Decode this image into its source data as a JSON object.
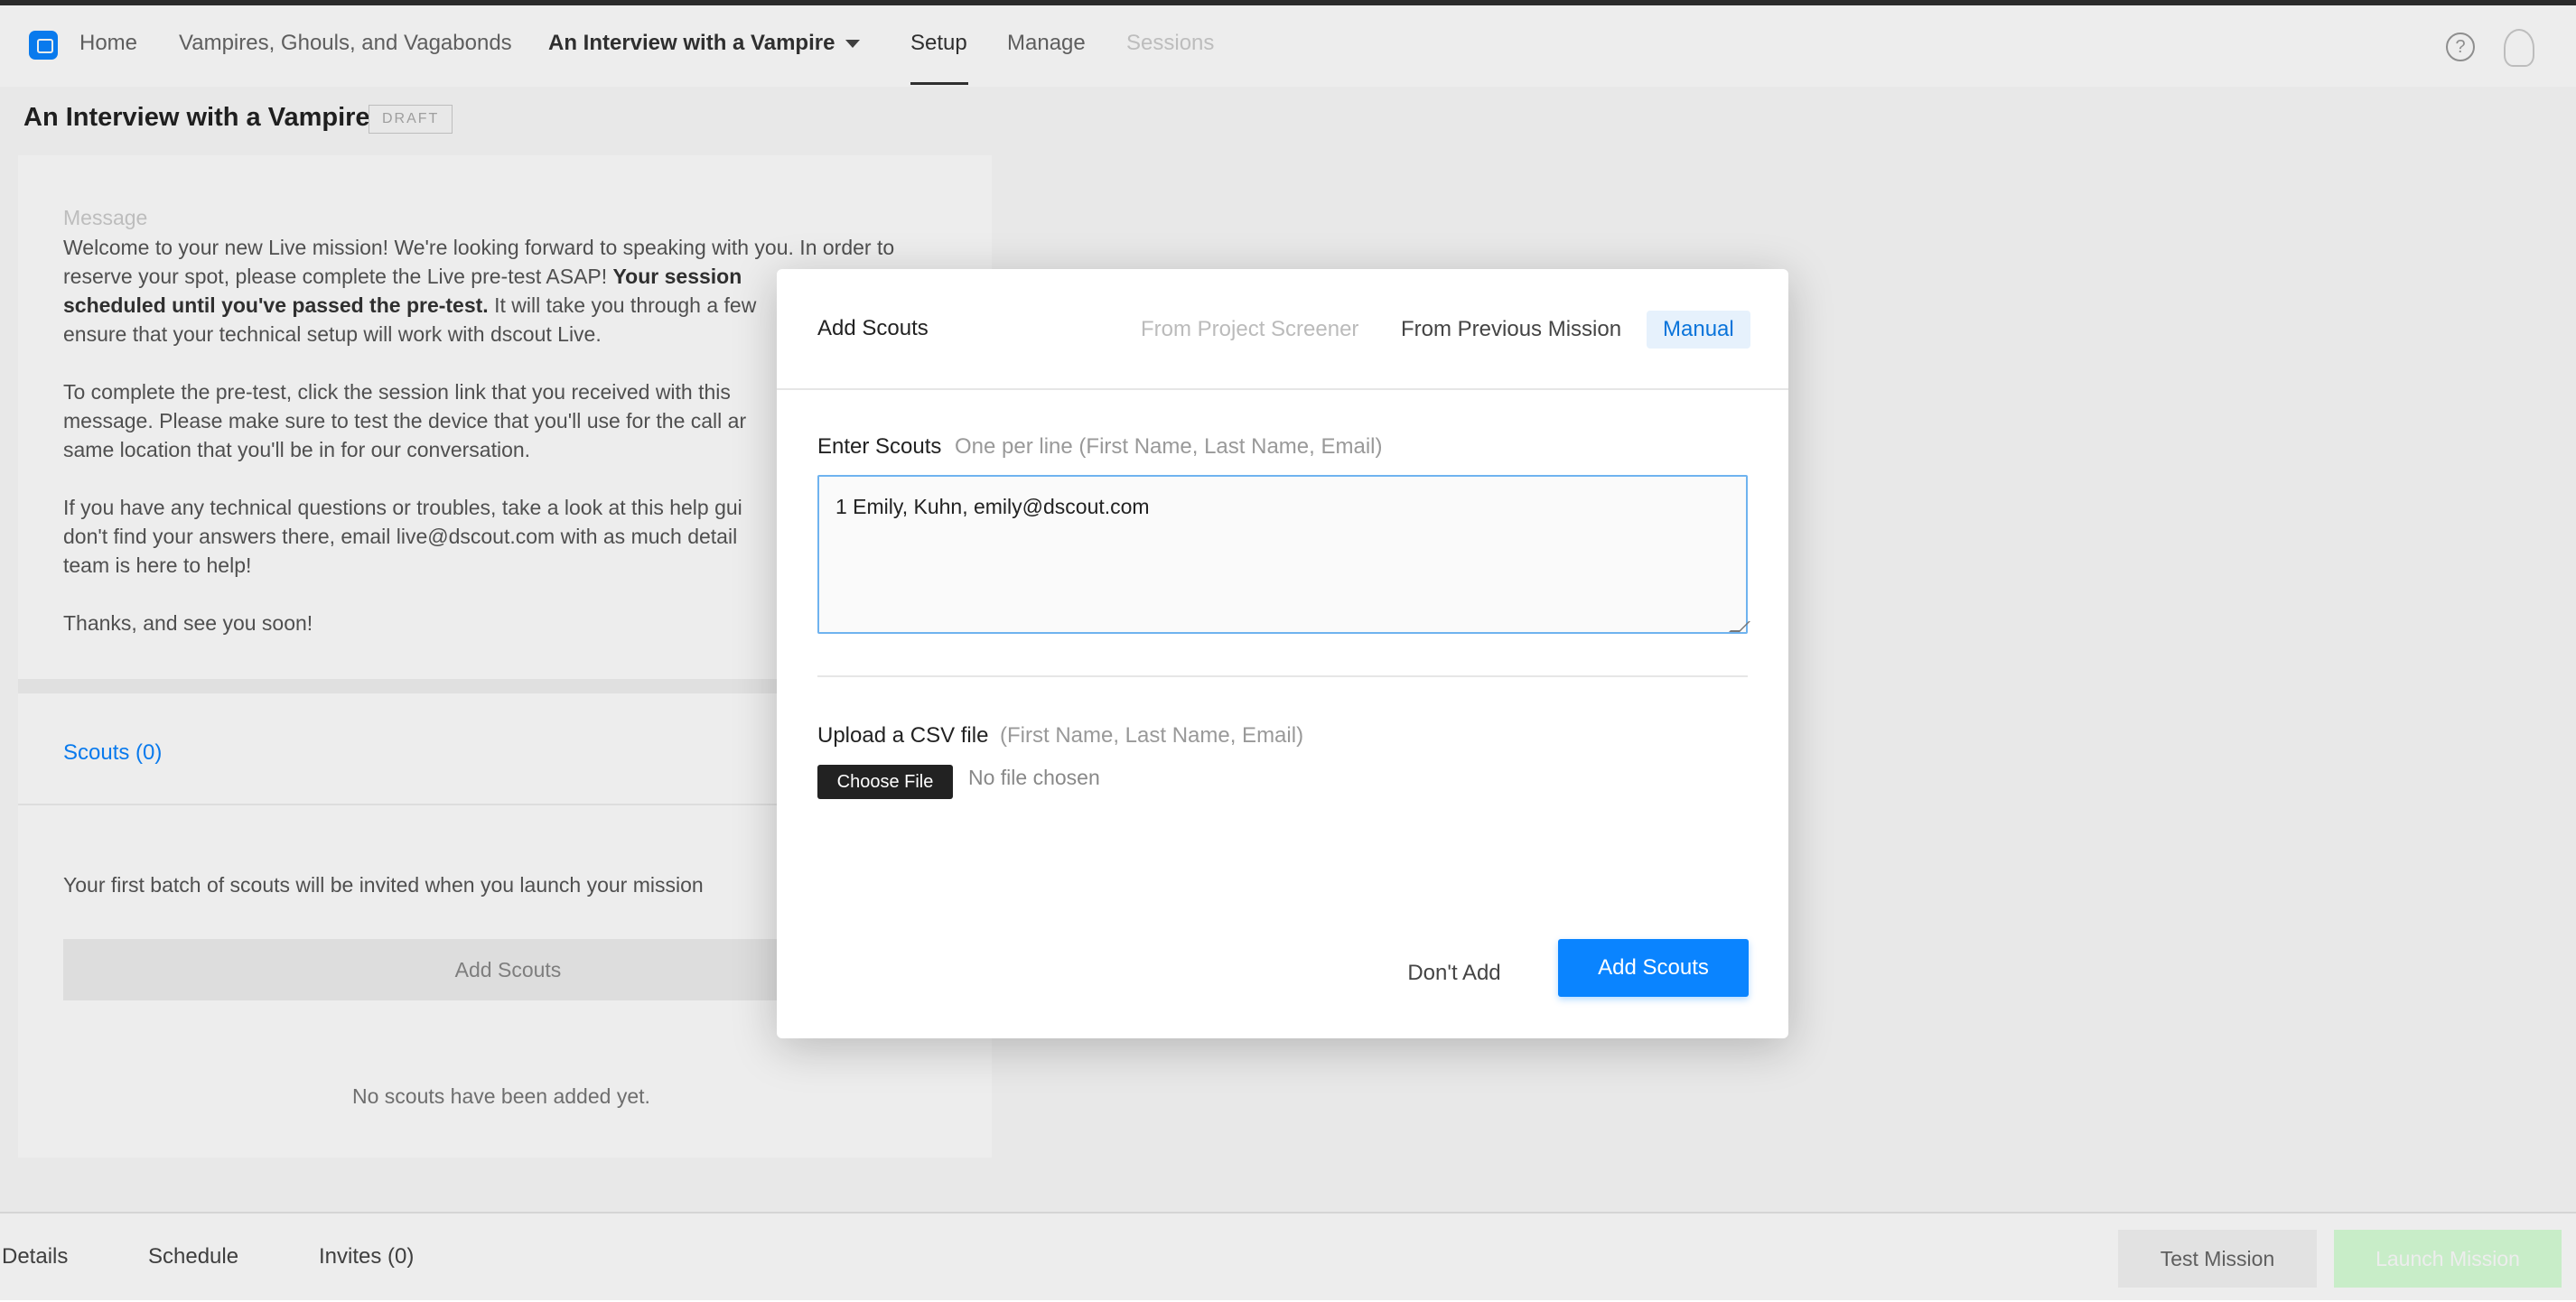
{
  "nav": {
    "home": "Home",
    "project": "Vampires, Ghouls, and Vagabonds",
    "mission": "An Interview with a Vampire",
    "setup": "Setup",
    "manage": "Manage",
    "sessions": "Sessions",
    "help_symbol": "?"
  },
  "page": {
    "title": "An Interview with a Vampire",
    "badge": "DRAFT"
  },
  "message": {
    "heading": "Message",
    "p1_a": "Welcome to your new Live mission! We're looking forward to speaking with you. In order to",
    "p1_b": "reserve your spot, please complete the Live pre-test ASAP!",
    "p1_c": "Your session",
    "p1_d": "scheduled until you've passed the pre-test.",
    "p1_e": "It will take you through a few",
    "p1_f": "ensure that your technical setup will work with dscout Live.",
    "p2_a": "To complete the pre-test, click the session link that you received with this",
    "p2_b": "message. Please make sure to test the device that you'll use for the call ar",
    "p2_c": "same location that you'll be in for our conversation.",
    "p3_a": "If you have any technical questions or troubles, take a look at this help gui",
    "p3_b": "don't find your answers there, email live@dscout.com with as much detail",
    "p3_c": "team is here to help!",
    "p4": "Thanks, and see you soon!"
  },
  "scouts_panel": {
    "heading": "Scouts (0)",
    "note": "Your first batch of scouts will be invited when you launch your mission",
    "add_button": "Add Scouts",
    "empty": "No scouts have been added yet."
  },
  "bottom_bar": {
    "details": "Details",
    "schedule": "Schedule",
    "invites": "Invites (0)",
    "test_mission": "Test Mission",
    "launch_mission": "Launch Mission"
  },
  "modal": {
    "title": "Add Scouts",
    "tabs": {
      "screener": "From Project Screener",
      "previous": "From Previous Mission",
      "manual": "Manual"
    },
    "enter_label": "Enter Scouts",
    "enter_hint": "One per line (First Name, Last Name, Email)",
    "textarea_value": "1 Emily, Kuhn, emily@dscout.com",
    "upload_label": "Upload a CSV file",
    "upload_hint": "(First Name, Last Name, Email)",
    "choose_file": "Choose File",
    "no_file": "No file chosen",
    "dont_add": "Don't Add",
    "add_scouts": "Add Scouts"
  }
}
